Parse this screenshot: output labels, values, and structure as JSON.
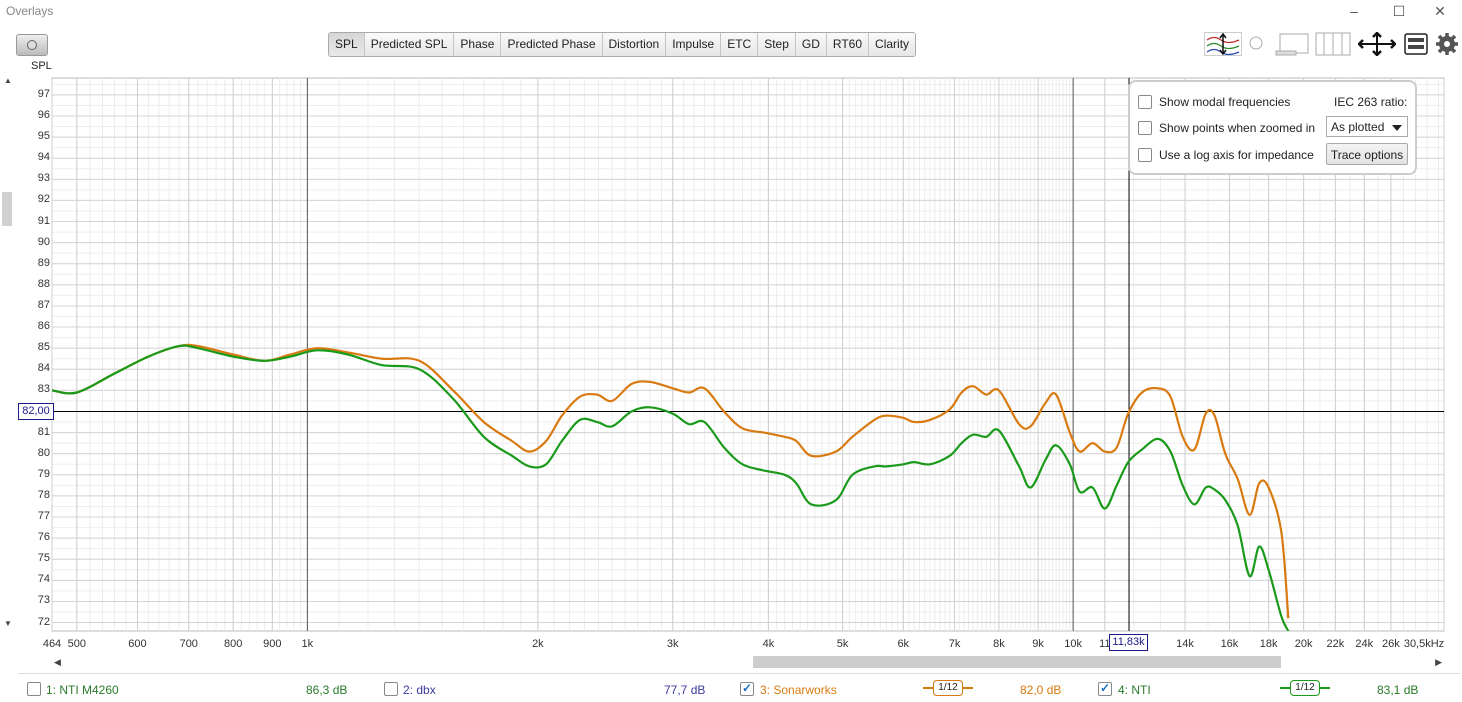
{
  "window": {
    "title": "Overlays",
    "controls": [
      "–",
      "☐",
      "✕"
    ]
  },
  "toolbar": {
    "tabs": [
      "SPL",
      "Predicted SPL",
      "Phase",
      "Predicted Phase",
      "Distortion",
      "Impulse",
      "ETC",
      "Step",
      "GD",
      "RT60",
      "Clarity"
    ],
    "active_tab": "SPL"
  },
  "options_panel": {
    "show_modal_frequencies": {
      "label": "Show modal frequencies",
      "checked": false
    },
    "show_points_zoomed": {
      "label": "Show points when zoomed in",
      "checked": false
    },
    "log_axis_impedance": {
      "label": "Use a log axis for impedance",
      "checked": false
    },
    "iec_label": "IEC 263 ratio:",
    "iec_select_value": "As plotted",
    "trace_options_label": "Trace options"
  },
  "cursor": {
    "y_readout": "82,00",
    "x_readout": "11,83k",
    "y_value": 82,
    "x_value": 11830
  },
  "legend": [
    {
      "index_label": "1: NTI M4260",
      "value": "86,3 dB",
      "checked": false,
      "color": "#2a7a2a",
      "value_color": "#2a7a2a"
    },
    {
      "index_label": "2: dbx",
      "value": "77,7 dB",
      "checked": false,
      "color": "#3a3aa0",
      "value_color": "#3a3aa0"
    },
    {
      "index_label": "3: Sonarworks",
      "value": "82,0 dB",
      "checked": true,
      "color": "#d97a10",
      "value_color": "#d97a10",
      "smoothing": "1/12"
    },
    {
      "index_label": "4: NTI",
      "value": "83,1 dB",
      "checked": true,
      "color": "#1a9a1a",
      "value_color": "#2a7a2a",
      "smoothing": "1/12"
    }
  ],
  "chart_data": {
    "type": "line",
    "ylabel": "SPL",
    "xlabel": "",
    "x_scale": "log",
    "xlim": [
      464,
      30500
    ],
    "ylim": [
      71.6,
      97.8
    ],
    "y_ticks": [
      72,
      73,
      74,
      75,
      76,
      77,
      78,
      79,
      80,
      81,
      82,
      83,
      84,
      85,
      86,
      87,
      88,
      89,
      90,
      91,
      92,
      93,
      94,
      95,
      96,
      97
    ],
    "x_ticks": [
      {
        "v": 464,
        "label": "464"
      },
      {
        "v": 500,
        "label": "500"
      },
      {
        "v": 600,
        "label": "600"
      },
      {
        "v": 700,
        "label": "700"
      },
      {
        "v": 800,
        "label": "800"
      },
      {
        "v": 900,
        "label": "900"
      },
      {
        "v": 1000,
        "label": "1k"
      },
      {
        "v": 2000,
        "label": "2k"
      },
      {
        "v": 3000,
        "label": "3k"
      },
      {
        "v": 4000,
        "label": "4k"
      },
      {
        "v": 5000,
        "label": "5k"
      },
      {
        "v": 6000,
        "label": "6k"
      },
      {
        "v": 7000,
        "label": "7k"
      },
      {
        "v": 8000,
        "label": "8k"
      },
      {
        "v": 9000,
        "label": "9k"
      },
      {
        "v": 10000,
        "label": "10k"
      },
      {
        "v": 11000,
        "label": "11"
      },
      {
        "v": 14000,
        "label": "14k"
      },
      {
        "v": 16000,
        "label": "16k"
      },
      {
        "v": 18000,
        "label": "18k"
      },
      {
        "v": 20000,
        "label": "20k"
      },
      {
        "v": 22000,
        "label": "22k"
      },
      {
        "v": 24000,
        "label": "24k"
      },
      {
        "v": 26000,
        "label": "26k"
      },
      {
        "v": 30500,
        "label": "30,5kHz"
      }
    ],
    "grid": true,
    "series": [
      {
        "name": "3: Sonarworks",
        "color": "#d97a10",
        "points": [
          [
            464,
            83.0
          ],
          [
            500,
            82.9
          ],
          [
            560,
            83.8
          ],
          [
            620,
            84.6
          ],
          [
            680,
            85.1
          ],
          [
            720,
            85.1
          ],
          [
            800,
            84.7
          ],
          [
            880,
            84.4
          ],
          [
            950,
            84.7
          ],
          [
            1030,
            85.0
          ],
          [
            1130,
            84.8
          ],
          [
            1250,
            84.5
          ],
          [
            1400,
            84.4
          ],
          [
            1550,
            83.0
          ],
          [
            1700,
            81.5
          ],
          [
            1850,
            80.6
          ],
          [
            1950,
            80.1
          ],
          [
            2050,
            80.6
          ],
          [
            2150,
            81.8
          ],
          [
            2270,
            82.7
          ],
          [
            2390,
            82.8
          ],
          [
            2500,
            82.5
          ],
          [
            2650,
            83.3
          ],
          [
            2800,
            83.4
          ],
          [
            3000,
            83.1
          ],
          [
            3150,
            82.9
          ],
          [
            3300,
            83.1
          ],
          [
            3500,
            82.0
          ],
          [
            3700,
            81.2
          ],
          [
            3950,
            81.0
          ],
          [
            4200,
            80.8
          ],
          [
            4350,
            80.6
          ],
          [
            4550,
            79.9
          ],
          [
            4900,
            80.1
          ],
          [
            5150,
            80.8
          ],
          [
            5500,
            81.6
          ],
          [
            5700,
            81.8
          ],
          [
            6000,
            81.7
          ],
          [
            6200,
            81.5
          ],
          [
            6500,
            81.6
          ],
          [
            6900,
            82.1
          ],
          [
            7150,
            82.9
          ],
          [
            7400,
            83.2
          ],
          [
            7700,
            82.8
          ],
          [
            8000,
            83.0
          ],
          [
            8500,
            81.4
          ],
          [
            8800,
            81.3
          ],
          [
            9200,
            82.4
          ],
          [
            9500,
            82.8
          ],
          [
            9900,
            81.0
          ],
          [
            10200,
            80.1
          ],
          [
            10600,
            80.5
          ],
          [
            11000,
            80.1
          ],
          [
            11400,
            80.3
          ],
          [
            11800,
            81.9
          ],
          [
            12300,
            82.9
          ],
          [
            12900,
            83.1
          ],
          [
            13400,
            82.7
          ],
          [
            13900,
            80.8
          ],
          [
            14400,
            80.2
          ],
          [
            14900,
            81.9
          ],
          [
            15300,
            81.8
          ],
          [
            15800,
            80.0
          ],
          [
            16400,
            78.8
          ],
          [
            17000,
            77.1
          ],
          [
            17500,
            78.6
          ],
          [
            18000,
            78.4
          ],
          [
            18700,
            76.3
          ],
          [
            19100,
            72.2
          ]
        ]
      },
      {
        "name": "4: NTI",
        "color": "#1a9a1a",
        "points": [
          [
            464,
            83.0
          ],
          [
            500,
            82.9
          ],
          [
            560,
            83.8
          ],
          [
            620,
            84.6
          ],
          [
            680,
            85.1
          ],
          [
            720,
            85.0
          ],
          [
            800,
            84.6
          ],
          [
            880,
            84.4
          ],
          [
            950,
            84.6
          ],
          [
            1030,
            84.9
          ],
          [
            1130,
            84.7
          ],
          [
            1250,
            84.2
          ],
          [
            1400,
            84.0
          ],
          [
            1550,
            82.6
          ],
          [
            1700,
            80.8
          ],
          [
            1850,
            79.9
          ],
          [
            1950,
            79.4
          ],
          [
            2050,
            79.5
          ],
          [
            2150,
            80.6
          ],
          [
            2270,
            81.6
          ],
          [
            2390,
            81.5
          ],
          [
            2500,
            81.3
          ],
          [
            2650,
            82.0
          ],
          [
            2800,
            82.2
          ],
          [
            3000,
            81.9
          ],
          [
            3150,
            81.4
          ],
          [
            3300,
            81.5
          ],
          [
            3500,
            80.3
          ],
          [
            3700,
            79.5
          ],
          [
            3950,
            79.2
          ],
          [
            4200,
            79.0
          ],
          [
            4350,
            78.6
          ],
          [
            4550,
            77.6
          ],
          [
            4900,
            77.8
          ],
          [
            5150,
            79.0
          ],
          [
            5500,
            79.4
          ],
          [
            5700,
            79.4
          ],
          [
            6000,
            79.5
          ],
          [
            6200,
            79.6
          ],
          [
            6500,
            79.5
          ],
          [
            6900,
            79.9
          ],
          [
            7150,
            80.5
          ],
          [
            7400,
            80.9
          ],
          [
            7700,
            80.8
          ],
          [
            8000,
            81.1
          ],
          [
            8500,
            79.4
          ],
          [
            8800,
            78.4
          ],
          [
            9200,
            79.7
          ],
          [
            9500,
            80.4
          ],
          [
            9900,
            79.5
          ],
          [
            10200,
            78.2
          ],
          [
            10600,
            78.4
          ],
          [
            11000,
            77.4
          ],
          [
            11400,
            78.5
          ],
          [
            11800,
            79.6
          ],
          [
            12300,
            80.2
          ],
          [
            12900,
            80.7
          ],
          [
            13400,
            80.1
          ],
          [
            13900,
            78.5
          ],
          [
            14400,
            77.6
          ],
          [
            14900,
            78.4
          ],
          [
            15300,
            78.3
          ],
          [
            15800,
            77.8
          ],
          [
            16400,
            76.6
          ],
          [
            17000,
            74.2
          ],
          [
            17500,
            75.6
          ],
          [
            18000,
            74.5
          ],
          [
            18700,
            72.3
          ],
          [
            19100,
            71.6
          ]
        ]
      }
    ]
  }
}
